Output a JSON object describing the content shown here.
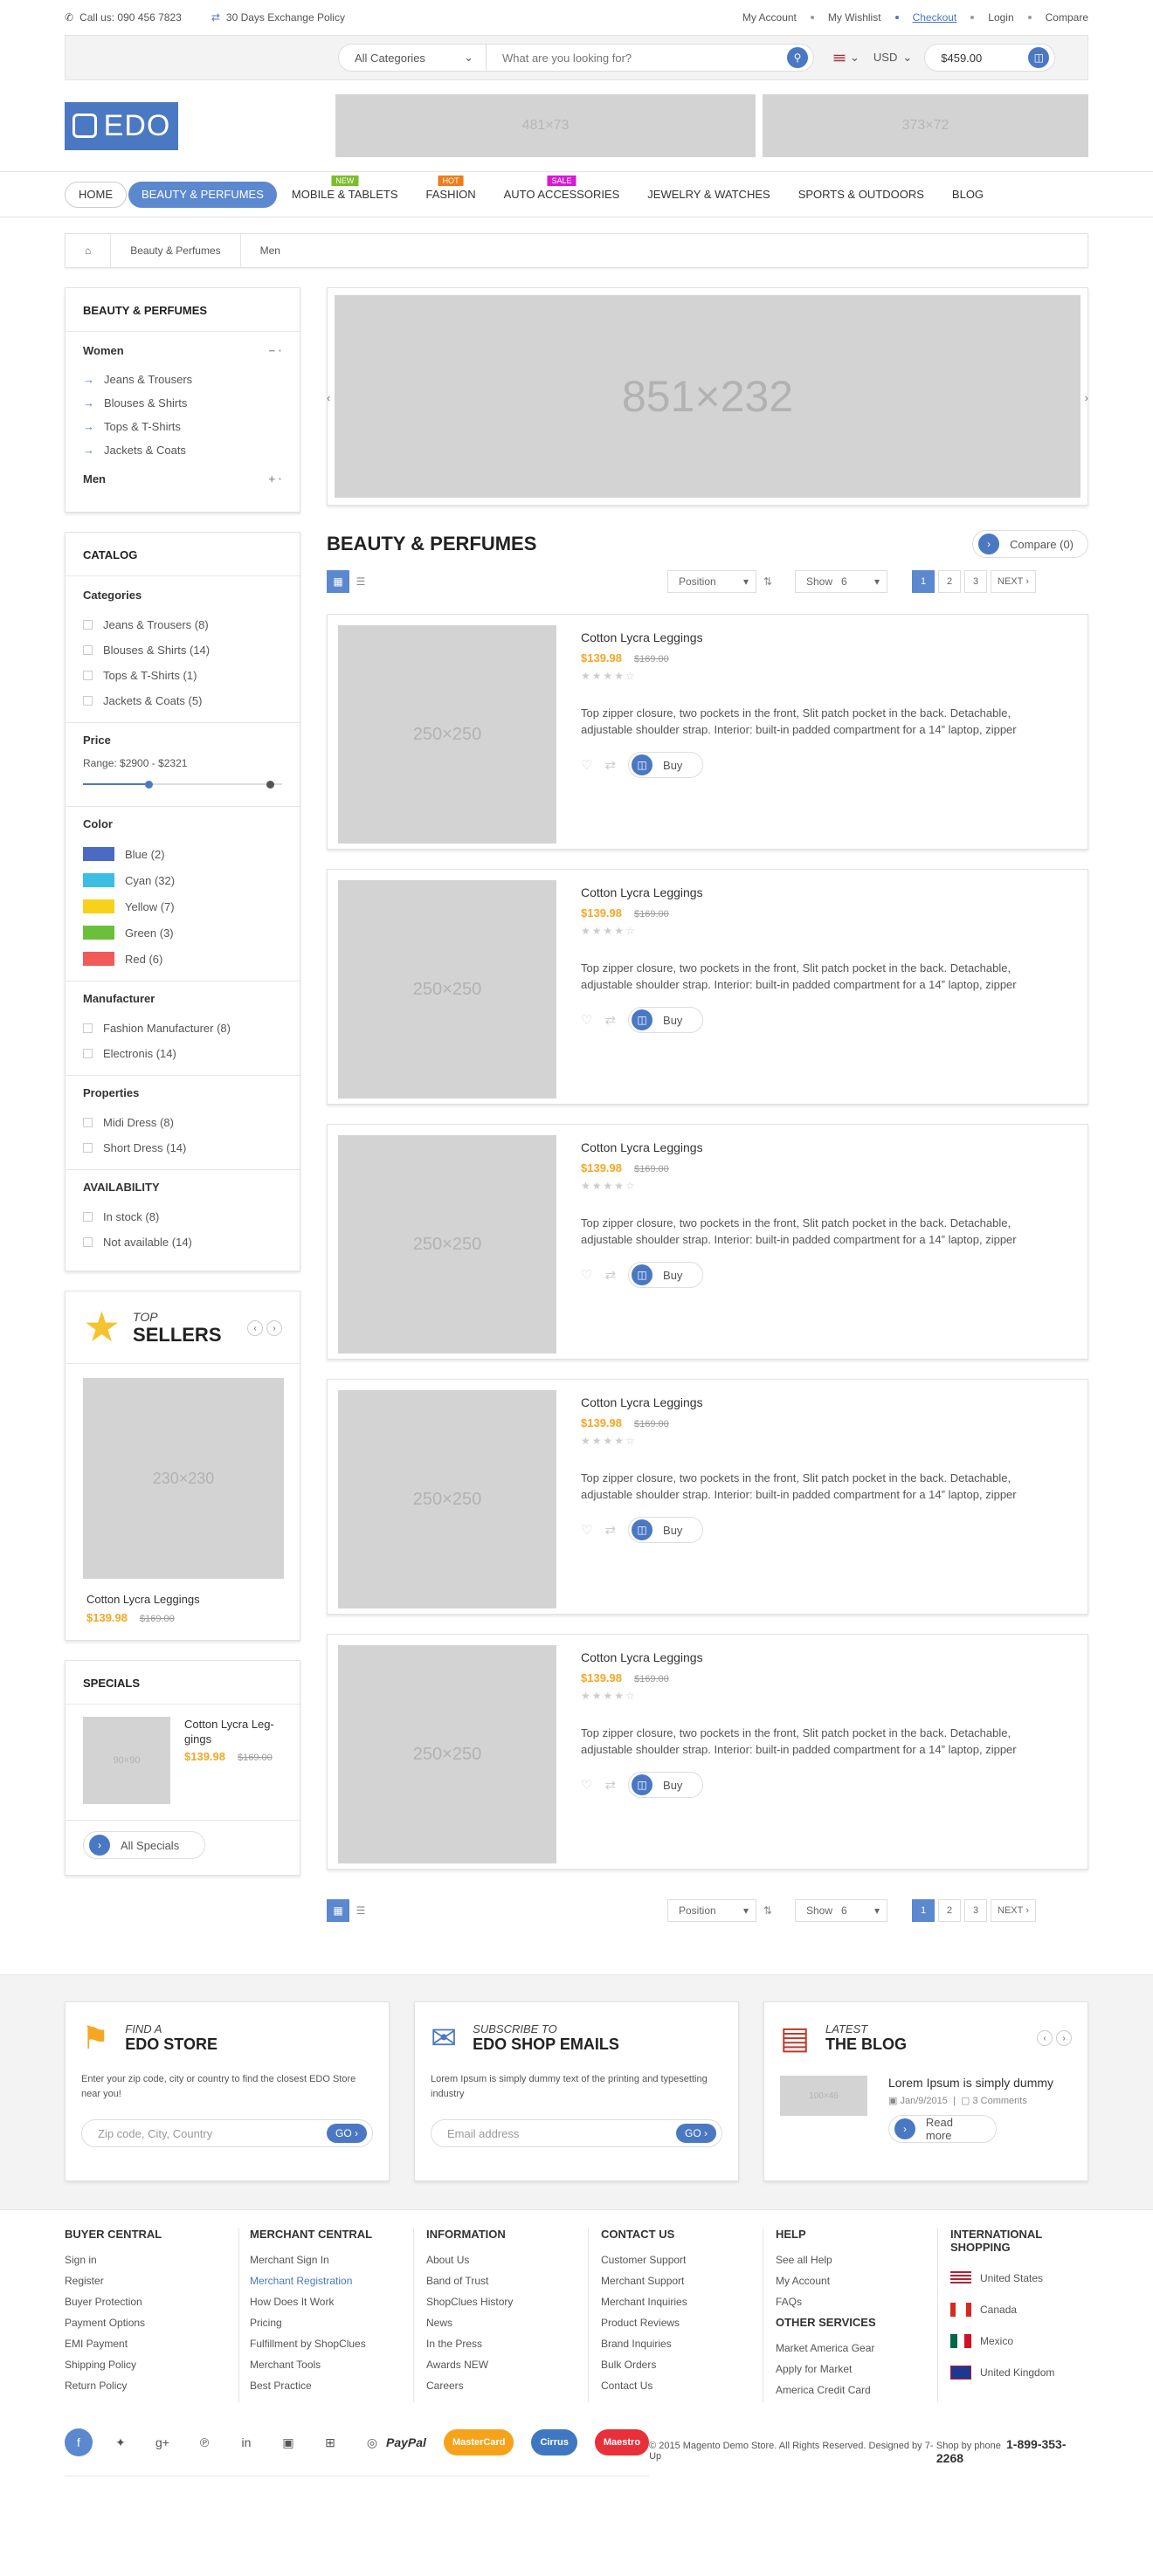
{
  "topbar": {
    "phone": "Call us: 090 456 7823",
    "exchange": "30 Days Exchange Policy",
    "links": [
      "My Account",
      "My Wishlist",
      "Checkout",
      "Login",
      "Compare"
    ]
  },
  "search": {
    "category": "All Categories",
    "placeholder": "What are you looking for?",
    "currency": "USD",
    "cart_total": "$459.00"
  },
  "logo_text": "EDO",
  "banners": [
    "481×73",
    "373×72"
  ],
  "nav": [
    {
      "label": "HOME",
      "badge": ""
    },
    {
      "label": "BEAUTY & PERFUMES",
      "badge": ""
    },
    {
      "label": "MOBILE & TABLETS",
      "badge": "NEW"
    },
    {
      "label": "FASHION",
      "badge": "HOT"
    },
    {
      "label": "AUTO ACCESSORIES",
      "badge": "SALE"
    },
    {
      "label": "JEWELRY & WATCHES",
      "badge": ""
    },
    {
      "label": "SPORTS & OUTDOORS",
      "badge": ""
    },
    {
      "label": "BLOG",
      "badge": ""
    }
  ],
  "breadcrumb": [
    "Beauty & Perfumes",
    "Men"
  ],
  "sidebar": {
    "categories_title": "BEAUTY & PERFUMES",
    "women": "Women",
    "women_items": [
      "Jeans & Trousers",
      "Blouses & Shirts",
      "Tops & T-Shirts",
      "Jackets & Coats"
    ],
    "men": "Men",
    "catalog_title": "CATALOG",
    "categories_label": "Categories",
    "cat_items": [
      "Jeans & Trousers  (8)",
      "Blouses & Shirts  (14)",
      "Tops & T-Shirts  (1)",
      "Jackets & Coats  (5)"
    ],
    "price_label": "Price",
    "price_range": "Range:  $2900  -  $2321",
    "color_label": "Color",
    "colors": [
      {
        "name": "Blue  (2)",
        "hex": "#4a6ac4"
      },
      {
        "name": "Cyan  (32)",
        "hex": "#3bbde4"
      },
      {
        "name": "Yellow  (7)",
        "hex": "#f7d21b"
      },
      {
        "name": "Green  (3)",
        "hex": "#6cbf3b"
      },
      {
        "name": "Red  (6)",
        "hex": "#f25a5a"
      }
    ],
    "manufacturer_label": "Manufacturer",
    "manufacturers": [
      "Fashion Manufacturer  (8)",
      "Electronis (14)"
    ],
    "properties_label": "Properties",
    "properties": [
      "Midi Dress  (8)",
      "Short Dress  (14)"
    ],
    "availability_label": "AVAILABILITY",
    "availability": [
      "In stock  (8)",
      "Not available  (14)"
    ],
    "top": "TOP",
    "sellers": "SELLERS",
    "seller_img": "230×230",
    "seller_name": "Cotton Lycra Leggings",
    "seller_price": "$139.98",
    "seller_old": "$169.00",
    "specials_title": "SPECIALS",
    "special_img": "90×90",
    "special_name": "Cotton Lycra Leg-gings",
    "special_price": "$139.98",
    "special_old": "$169.00",
    "all_specials": "All Specials"
  },
  "main": {
    "hero": "851×232",
    "title": "BEAUTY & PERFUMES",
    "compare": "Compare (0)",
    "sort": "Position",
    "show_label": "Show",
    "show_value": "6",
    "pages": [
      "1",
      "2",
      "3",
      "NEXT"
    ],
    "products": [
      {
        "img": "250×250",
        "name": "Cotton Lycra Leggings",
        "price": "$139.98",
        "old": "$169.00",
        "desc": "Top zipper closure, two pockets in the front, Slit patch pocket in the back. Detachable, adjustable shoulder strap. Interior: built-in padded compartment for a 14” laptop, zipper",
        "buy": "Buy"
      },
      {
        "img": "250×250",
        "name": "Cotton Lycra Leggings",
        "price": "$139.98",
        "old": "$169.00",
        "desc": "Top zipper closure, two pockets in the front, Slit patch pocket in the back. Detachable, adjustable shoulder strap. Interior: built-in padded compartment for a 14” laptop, zipper",
        "buy": "Buy"
      },
      {
        "img": "250×250",
        "name": "Cotton Lycra Leggings",
        "price": "$139.98",
        "old": "$169.00",
        "desc": "Top zipper closure, two pockets in the front, Slit patch pocket in the back. Detachable, adjustable shoulder strap. Interior: built-in padded compartment for a 14” laptop, zipper",
        "buy": "Buy"
      },
      {
        "img": "250×250",
        "name": "Cotton Lycra Leggings",
        "price": "$139.98",
        "old": "$169.00",
        "desc": "Top zipper closure, two pockets in the front, Slit patch pocket in the back. Detachable, adjustable shoulder strap. Interior: built-in padded compartment for a 14” laptop, zipper",
        "buy": "Buy"
      },
      {
        "img": "250×250",
        "name": "Cotton Lycra Leggings",
        "price": "$139.98",
        "old": "$169.00",
        "desc": "Top zipper closure, two pockets in the front, Slit patch pocket in the back. Detachable, adjustable shoulder strap. Interior: built-in padded compartment for a 14” laptop, zipper",
        "buy": "Buy"
      }
    ]
  },
  "footer": {
    "store_small": "FIND A",
    "store_big": "EDO STORE",
    "store_text": "Enter your zip code, city or country to find the closest EDO Store near you!",
    "store_placeholder": "Zip code, City, Country",
    "go": "GO",
    "sub_small": "SUBSCRIBE TO",
    "sub_big": "EDO SHOP EMAILS",
    "sub_text": "Lorem Ipsum is simply dummy text of the printing and typesetting industry",
    "sub_placeholder": "Email address",
    "blog_small": "LATEST",
    "blog_big": "THE BLOG",
    "blog_img": "100×46",
    "blog_title": "Lorem Ipsum is simply dummy",
    "blog_date": "Jan/9/2015",
    "blog_comments": "3 Comments",
    "read_more": "Read more",
    "columns": [
      {
        "title": "BUYER CENTRAL",
        "links": [
          "Sign in",
          "Register",
          "Buyer Protection",
          "Payment Options",
          "EMI Payment",
          "Shipping Policy",
          "Return Policy"
        ]
      },
      {
        "title": "MERCHANT CENTRAL",
        "links": [
          "Merchant Sign In",
          "Merchant Registration",
          "How Does It Work",
          "Pricing",
          "Fulfillment by ShopClues",
          "Merchant Tools",
          "Best Practice"
        ]
      },
      {
        "title": "INFORMATION",
        "links": [
          "About Us",
          "Band of Trust",
          "ShopClues History",
          "News",
          "In the Press",
          "Awards NEW",
          "Careers"
        ]
      },
      {
        "title": "CONTACT US",
        "links": [
          "Customer Support",
          "Merchant Support",
          "Merchant Inquiries",
          "Product Reviews",
          "Brand Inquiries",
          "Bulk Orders",
          "Contact Us"
        ]
      },
      {
        "title": "HELP",
        "links": [
          "See all Help",
          "My Account",
          "FAQs"
        ]
      }
    ],
    "other_title": "OTHER SERVICES",
    "other_links": [
      "Market America Gear",
      "Apply for Market",
      "America Credit Card"
    ],
    "intl_title": "INTERNATIONAL SHOPPING",
    "countries": [
      "United States",
      "Canada",
      "Mexico",
      "United Kingdom"
    ],
    "payments": [
      "PayPal",
      "MasterCard",
      "Cirrus",
      "Maestro"
    ],
    "copyright": "© 2015 Magento Demo Store. All Rights Reserved. Designed by 7-Up",
    "phone_label": "Shop by phone",
    "phone": "1-899-353-2268"
  }
}
